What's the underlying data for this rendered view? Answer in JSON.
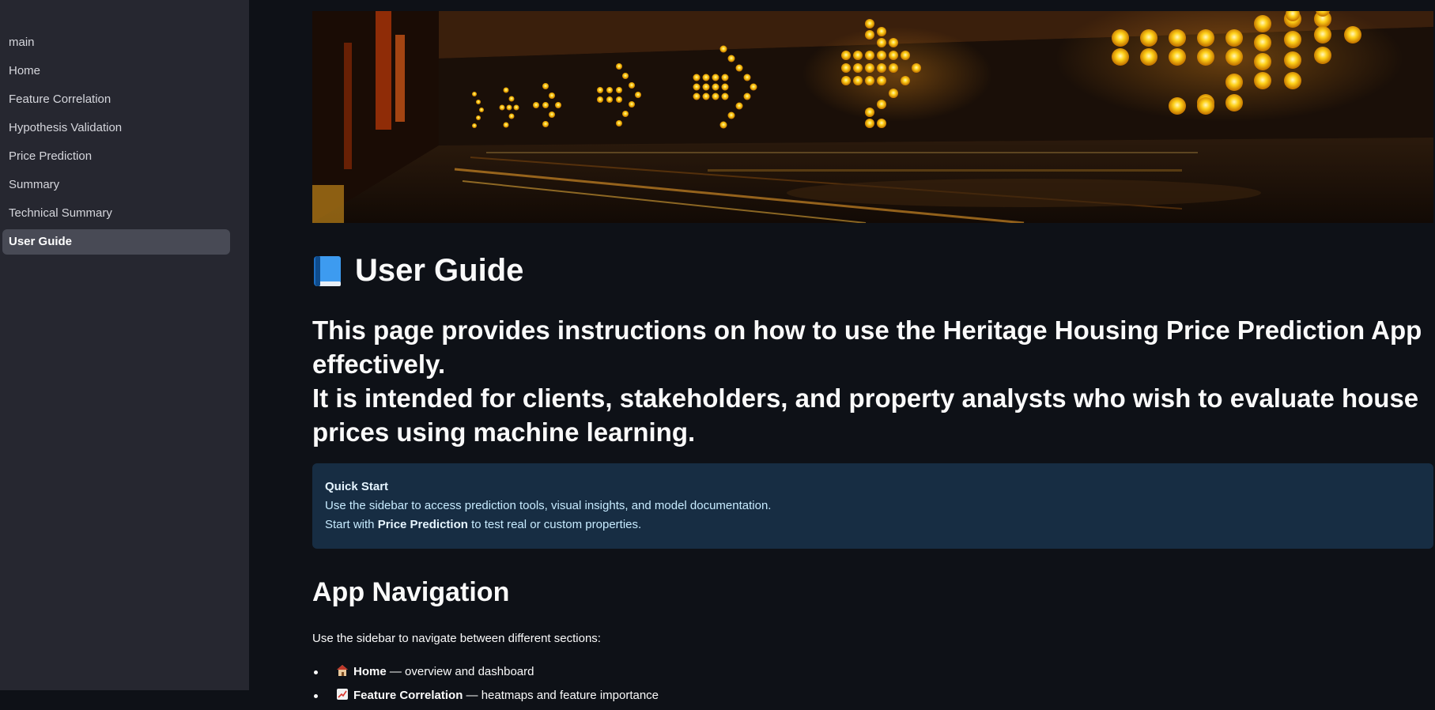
{
  "sidebar": {
    "items": [
      {
        "label": "main",
        "active": false
      },
      {
        "label": "Home",
        "active": false
      },
      {
        "label": "Feature Correlation",
        "active": false
      },
      {
        "label": "Hypothesis Validation",
        "active": false
      },
      {
        "label": "Price Prediction",
        "active": false
      },
      {
        "label": "Summary",
        "active": false
      },
      {
        "label": "Technical Summary",
        "active": false
      },
      {
        "label": "User Guide",
        "active": true
      }
    ]
  },
  "page": {
    "title": "User Guide",
    "intro_line1": "This page provides instructions on how to use the Heritage Housing Price Prediction App effectively.",
    "intro_line2": "It is intended for clients, stakeholders, and property analysts who wish to evaluate house prices using machine learning."
  },
  "quick_start": {
    "heading": "Quick Start",
    "line1": "Use the sidebar to access prediction tools, visual insights, and model documentation.",
    "line2_prefix": "Start with ",
    "line2_bold": "Price Prediction",
    "line2_suffix": " to test real or custom properties."
  },
  "navigation": {
    "heading": "App Navigation",
    "description": "Use the sidebar to navigate between different sections:",
    "sections": [
      {
        "icon": "house-icon",
        "name": "Home",
        "desc": " — overview and dashboard"
      },
      {
        "icon": "chart-icon",
        "name": "Feature Correlation",
        "desc": " — heatmaps and feature importance"
      }
    ]
  },
  "colors": {
    "sidebar_bg": "#262730",
    "main_bg": "#0e1117",
    "active_item_bg": "#484a55",
    "info_bg": "#172d43",
    "info_text": "#c7ebff"
  }
}
